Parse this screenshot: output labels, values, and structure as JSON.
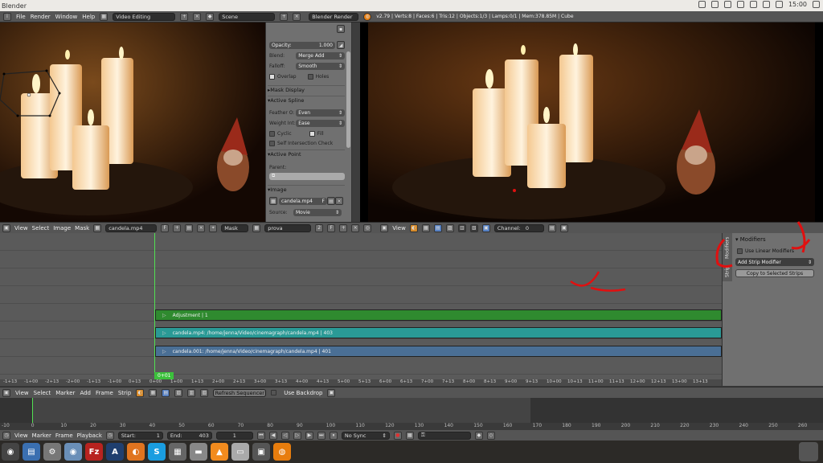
{
  "os": {
    "window_title": "Blender",
    "clock": "15:00"
  },
  "info_header": {
    "menus": [
      "File",
      "Render",
      "Window",
      "Help"
    ],
    "screen_layout": "Video Editing",
    "scene": "Scene",
    "engine": "Blender Render",
    "stats": "v2.79 | Verts:8 | Faces:6 | Tris:12 | Objects:1/3 | Lamps:0/1 | Mem:378.85M | Cube"
  },
  "properties": {
    "opacity_label": "Opacity:",
    "opacity_value": "1.000",
    "blend_label": "Blend:",
    "blend_value": "Merge Add",
    "falloff_label": "Falloff:",
    "falloff_value": "Smooth",
    "overlap_label": "Overlap",
    "holes_label": "Holes",
    "mask_display": "Mask Display",
    "active_spline": "Active Spline",
    "feather_label": "Feather O:",
    "feather_value": "Even",
    "weight_label": "Weight Int:",
    "weight_value": "Ease",
    "cyclic_label": "Cyclic",
    "fill_label": "Fill",
    "self_intersection_label": "Self Intersection Check",
    "active_point": "Active Point",
    "parent_label": "Parent:",
    "image_panel": "Image",
    "image_name": "candela.mp4",
    "source_label": "Source:",
    "source_value": "Movie"
  },
  "image_header": {
    "menus": [
      "View",
      "Select",
      "Image",
      "Mask"
    ],
    "image_name": "candela.mp4",
    "frame_value": "F",
    "mode": "Mask",
    "mask_name": "prova",
    "users": "2",
    "f_label": "F"
  },
  "preview_header": {
    "menus": [
      "View"
    ],
    "channel_label": "Channel:",
    "channel_value": "0"
  },
  "sequencer": {
    "strips": [
      {
        "label": "Adjustment | 1",
        "color": "#2f8a2f"
      },
      {
        "label": "candela.mp4: /home/jenna/Video/cinemagraph/candela.mp4 | 403",
        "color": "#2a9a96"
      },
      {
        "label": "candela.001: /home/jenna/Video/cinemagraph/candela.mp4 | 401",
        "color": "#4a6f95"
      }
    ],
    "current_frame_label": "0+01",
    "ruler_labels": [
      "-1+13",
      "-1+00",
      "-2+13",
      "-2+00",
      "-1+13",
      "-1+00",
      "0+13",
      "0+00",
      "1+00",
      "1+13",
      "2+00",
      "2+13",
      "3+00",
      "3+13",
      "4+00",
      "4+13",
      "5+00",
      "5+13",
      "6+00",
      "6+13",
      "7+00",
      "7+13",
      "8+00",
      "8+13",
      "9+00",
      "9+13",
      "10+00",
      "10+13",
      "11+00",
      "11+13",
      "12+00",
      "12+13",
      "13+00",
      "13+13"
    ]
  },
  "sidebar": {
    "tabs": [
      "Strip",
      "Modifiers"
    ],
    "section_title": "Modifiers",
    "use_linear_label": "Use Linear Modifiers",
    "add_modifier_label": "Add Strip Modifier",
    "copy_label": "Copy to Selected Strips"
  },
  "sequencer_header": {
    "menus": [
      "View",
      "Select",
      "Marker",
      "Add",
      "Frame",
      "Strip"
    ],
    "refresh_label": "Refresh Sequencer",
    "backdrop_label": "Use Backdrop"
  },
  "timeline": {
    "ruler": [
      "-10",
      "0",
      "10",
      "20",
      "30",
      "40",
      "50",
      "60",
      "70",
      "80",
      "90",
      "100",
      "110",
      "120",
      "130",
      "140",
      "150",
      "160",
      "170",
      "180",
      "190",
      "200",
      "210",
      "220",
      "230",
      "240",
      "250",
      "260"
    ]
  },
  "timeline_header": {
    "menus": [
      "View",
      "Marker",
      "Frame",
      "Playback"
    ],
    "start_label": "Start:",
    "start_value": "1",
    "end_label": "End:",
    "end_value": "403",
    "current_value": "1",
    "sync_value": "No Sync"
  },
  "taskbar": {
    "apps": [
      {
        "name": "files-icon",
        "color": "#3a6fb0",
        "glyph": "▤"
      },
      {
        "name": "settings-icon",
        "color": "#777",
        "glyph": "⚙"
      },
      {
        "name": "camera-icon",
        "color": "#6a8fb8",
        "glyph": "◉"
      },
      {
        "name": "filezilla-icon",
        "color": "#b8231f",
        "glyph": "Fz"
      },
      {
        "name": "inkscape-icon",
        "color": "#1f3f6f",
        "glyph": "A"
      },
      {
        "name": "firefox-icon",
        "color": "#e0741f",
        "glyph": "◐"
      },
      {
        "name": "skype-icon",
        "color": "#1a9de0",
        "glyph": "S"
      },
      {
        "name": "writer-icon",
        "color": "#666",
        "glyph": "▦"
      },
      {
        "name": "printer-icon",
        "color": "#888",
        "glyph": "▬"
      },
      {
        "name": "vlc-icon",
        "color": "#f28b1e",
        "glyph": "▲"
      },
      {
        "name": "notes-icon",
        "color": "#aaa",
        "glyph": "▭"
      },
      {
        "name": "scanner-icon",
        "color": "#555",
        "glyph": "▣"
      },
      {
        "name": "blender-icon",
        "color": "#e87d0d",
        "glyph": "◍"
      }
    ]
  }
}
